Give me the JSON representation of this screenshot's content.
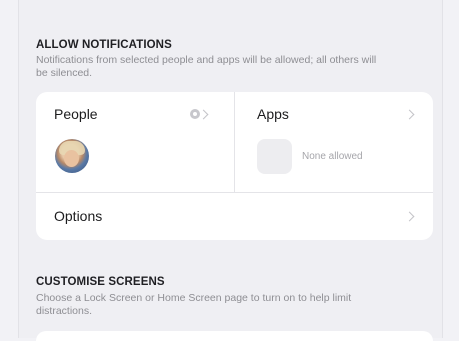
{
  "allow_notifications": {
    "header": "ALLOW NOTIFICATIONS",
    "footer": "Notifications from selected people and apps will be allowed; all others will be silenced."
  },
  "people": {
    "label": "People"
  },
  "apps": {
    "label": "Apps",
    "status": "None allowed"
  },
  "options": {
    "label": "Options"
  },
  "customise_screens": {
    "header": "CUSTOMISE SCREENS",
    "footer": "Choose a Lock Screen or Home Screen page to turn on to help limit distractions."
  }
}
